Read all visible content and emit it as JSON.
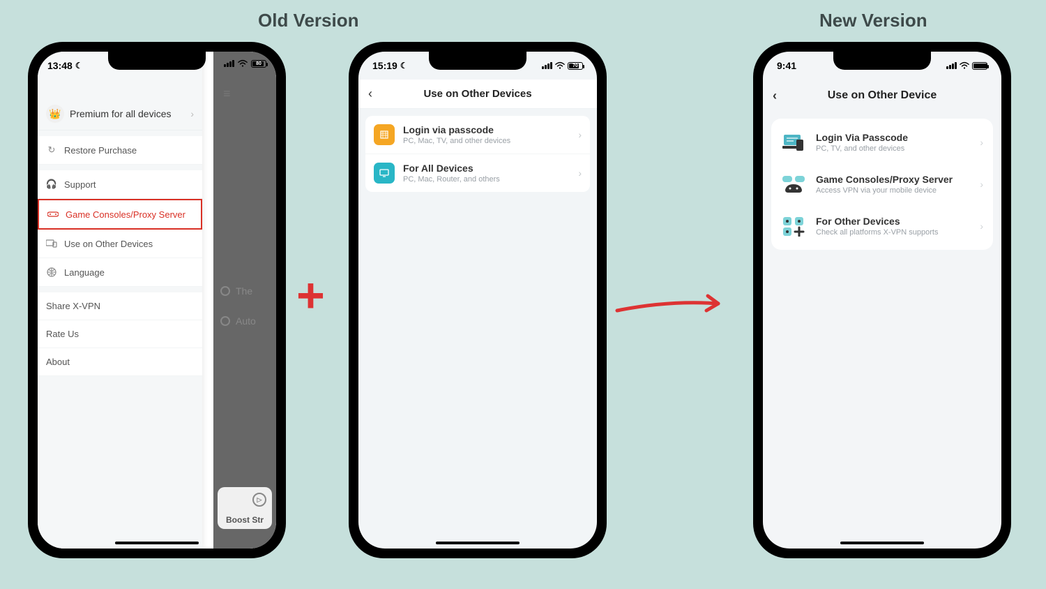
{
  "labels": {
    "old": "Old Version",
    "new": "New Version"
  },
  "phone1": {
    "status": {
      "time": "13:48",
      "battery": "80"
    },
    "header": {
      "title": "Premium for all devices"
    },
    "menu": {
      "restore": "Restore Purchase",
      "support": "Support",
      "game": "Game Consoles/Proxy Server",
      "use_other": "Use on Other Devices",
      "language": "Language",
      "share": "Share X-VPN",
      "rate": "Rate Us",
      "about": "About"
    },
    "bg": {
      "item1": "The",
      "item2": "Auto",
      "boost": "Boost Str"
    }
  },
  "phone2": {
    "status": {
      "time": "15:19",
      "battery": "70"
    },
    "header": {
      "title": "Use on Other Devices"
    },
    "rows": [
      {
        "title": "Login via passcode",
        "sub": "PC, Mac, TV, and other devices"
      },
      {
        "title": "For All Devices",
        "sub": "PC, Mac, Router, and others"
      }
    ]
  },
  "phone3": {
    "status": {
      "time": "9:41"
    },
    "header": {
      "title": "Use on Other Device"
    },
    "rows": [
      {
        "title": "Login Via Passcode",
        "sub": "PC, TV, and other devices"
      },
      {
        "title": "Game Consoles/Proxy Server",
        "sub": "Access VPN via your mobile device"
      },
      {
        "title": "For Other Devices",
        "sub": "Check all platforms X-VPN supports"
      }
    ]
  }
}
